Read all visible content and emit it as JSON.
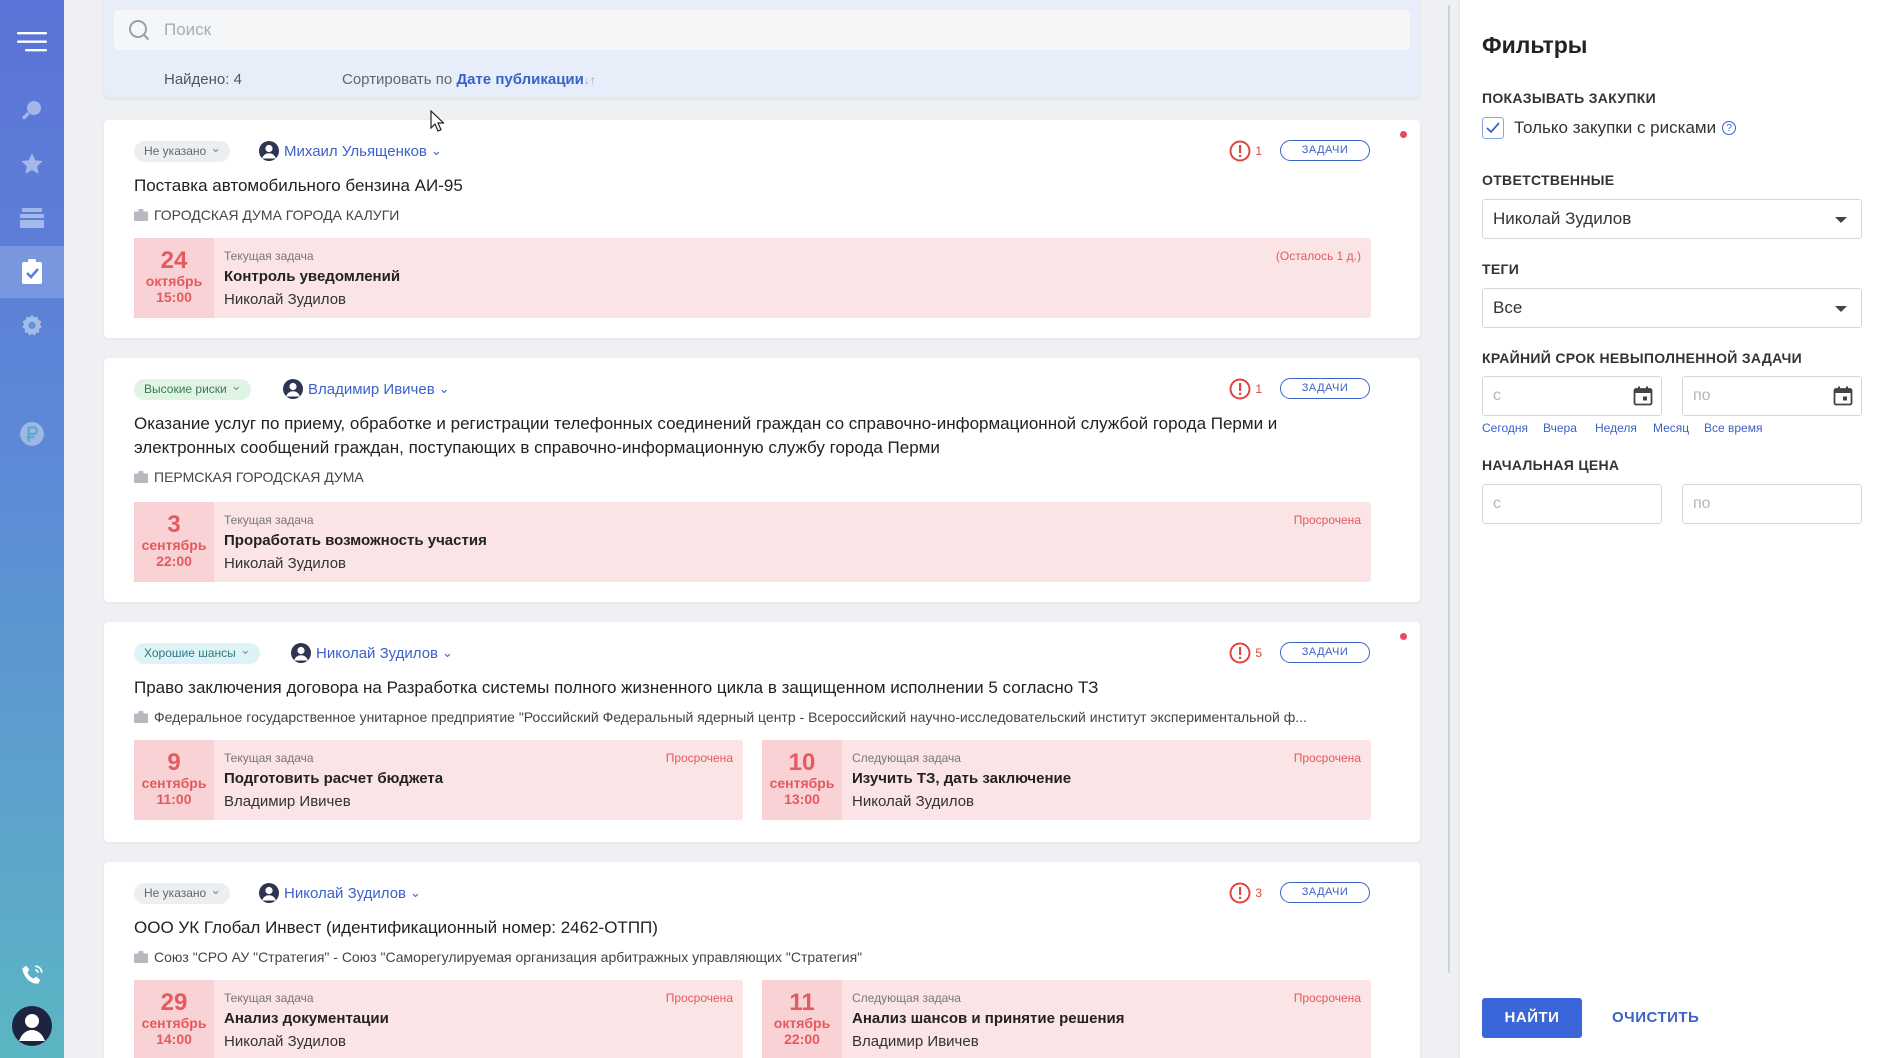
{
  "nav": {
    "items": [
      {
        "icon": "menu-icon"
      },
      {
        "icon": "search-icon"
      },
      {
        "icon": "star-icon"
      },
      {
        "icon": "archive-icon"
      },
      {
        "icon": "tasks-icon",
        "active": true
      },
      {
        "icon": "gear-icon"
      },
      {
        "icon": "ruble-icon"
      }
    ],
    "bottom": [
      {
        "icon": "phone-icon"
      },
      {
        "icon": "avatar-icon"
      }
    ]
  },
  "search": {
    "placeholder": "Поиск"
  },
  "results": {
    "found": "Найдено: 4",
    "sort_prefix": "Сортировать по",
    "sort_field": "Дате публикации",
    "sort_arrows": "↓↑"
  },
  "cards": [
    {
      "chip": "Не указано",
      "person": "Михаил Ульященков",
      "alert_count": "1",
      "tasks_label": "ЗАДАЧИ",
      "title": "Поставка автомобильного бензина АИ-95",
      "org": "ГОРОДСКАЯ ДУМА ГОРОДА КАЛУГИ",
      "tasks": [
        {
          "day": "24",
          "month": "октябрь",
          "time": "15:00",
          "label": "Текущая задача",
          "name": "Контроль уведомлений",
          "who": "Николай Зудилов",
          "status": "(Осталось 1 д.)"
        }
      ]
    },
    {
      "chip": "Высокие риски",
      "person": "Владимир Ивичев",
      "alert_count": "1",
      "tasks_label": "ЗАДАЧИ",
      "title": "Оказание услуг по приему, обработке и регистрации телефонных соединений граждан со справочно-информационной службой города Перми и электронных сообщений граждан, поступающих в справочно-информационную службу города Перми",
      "org": "ПЕРМСКАЯ ГОРОДСКАЯ ДУМА",
      "tasks": [
        {
          "day": "3",
          "month": "сентябрь",
          "time": "22:00",
          "label": "Текущая задача",
          "name": "Проработать возможность участия",
          "who": "Николай Зудилов",
          "status": "Просрочена"
        }
      ]
    },
    {
      "chip": "Хорошие шансы",
      "person": "Николай Зудилов",
      "alert_count": "5",
      "tasks_label": "ЗАДАЧИ",
      "title": "Право заключения договора на Разработка системы полного жизненного цикла в защищенном исполнении 5 согласно ТЗ",
      "org": "Федеральное государственное унитарное предприятие \"Российский Федеральный ядерный центр - Всероссийский научно-исследовательский институт экспериментальной ф...",
      "tasks": [
        {
          "day": "9",
          "month": "сентябрь",
          "time": "11:00",
          "label": "Текущая задача",
          "name": "Подготовить расчет бюджета",
          "who": "Владимир Ивичев",
          "status": "Просрочена"
        },
        {
          "day": "10",
          "month": "сентябрь",
          "time": "13:00",
          "label": "Следующая задача",
          "name": "Изучить ТЗ, дать заключение",
          "who": "Николай Зудилов",
          "status": "Просрочена"
        }
      ]
    },
    {
      "chip": "Не указано",
      "person": "Николай Зудилов",
      "alert_count": "3",
      "tasks_label": "ЗАДАЧИ",
      "title": "ООО УК Глобал Инвест (идентификационный номер: 2462-ОТПП)",
      "org": "Союз \"СРО АУ \"Стратегия\" - Союз \"Саморегулируемая организация арбитражных управляющих \"Стратегия\"",
      "tasks": [
        {
          "day": "29",
          "month": "сентябрь",
          "time": "14:00",
          "label": "Текущая задача",
          "name": "Анализ документации",
          "who": "Николай Зудилов",
          "status": "Просрочена"
        },
        {
          "day": "11",
          "month": "октябрь",
          "time": "22:00",
          "label": "Следующая задача",
          "name": "Анализ шансов и принятие решения",
          "who": "Владимир Ивичев",
          "status": "Просрочена"
        }
      ]
    }
  ],
  "filters": {
    "title": "Фильтры",
    "show_label": "ПОКАЗЫВАТЬ ЗАКУПКИ",
    "risk_only_label": "Только закупки с рисками",
    "risk_only_checked": true,
    "help_glyph": "?",
    "responsible_label": "ОТВЕТСТВЕННЫЕ",
    "responsible_value": "Николай Зудилов",
    "tags_label": "ТЕГИ",
    "tags_value": "Все",
    "deadline_label": "КРАЙНИЙ СРОК НЕВЫПОЛНЕННОЙ ЗАДАЧИ",
    "from_placeholder": "с",
    "to_placeholder": "по",
    "quick": [
      "Сегодня",
      "Вчера",
      "Неделя",
      "Месяц",
      "Все время"
    ],
    "price_label": "НАЧАЛЬНАЯ ЦЕНА",
    "price_from_placeholder": "с",
    "price_to_placeholder": "по",
    "find_button": "НАЙТИ",
    "clear_button": "ОЧИСТИТЬ"
  },
  "colors": {
    "accent": "#3a62c9",
    "danger": "#e45a5e",
    "task_bg": "#fbe4e5"
  }
}
